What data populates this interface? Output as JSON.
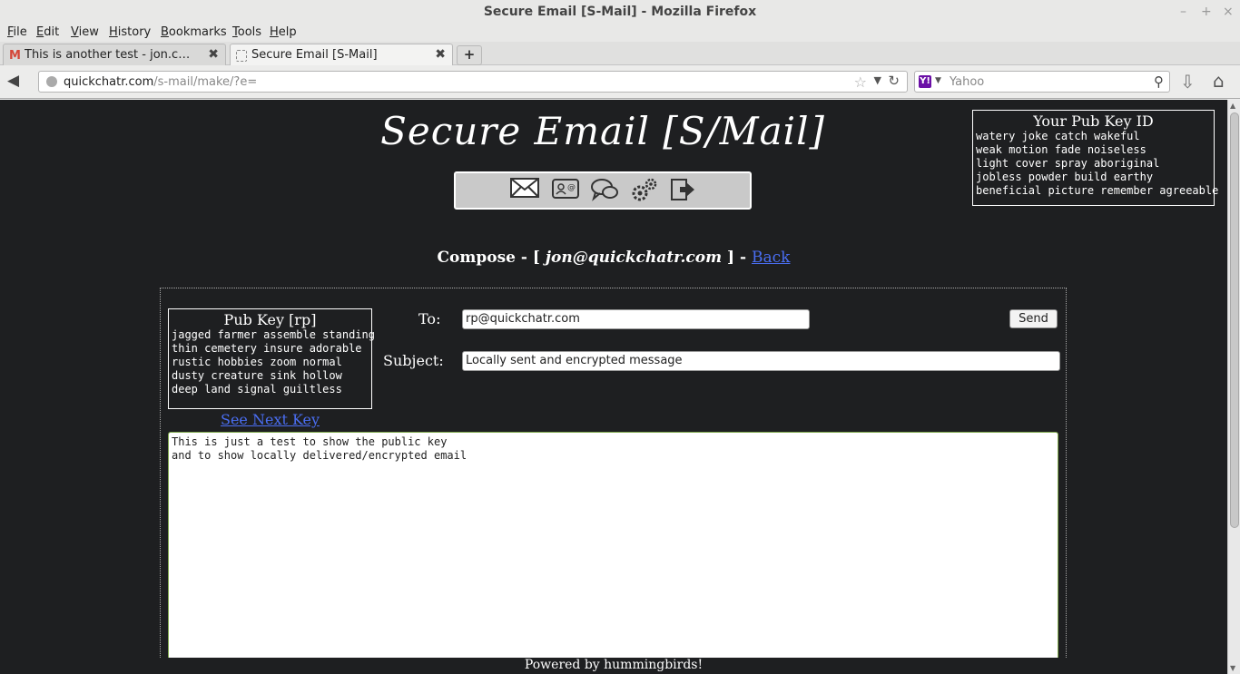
{
  "window": {
    "title": "Secure Email [S-Mail] - Mozilla Firefox",
    "controls": [
      "–",
      "+",
      "×"
    ]
  },
  "menu": [
    "File",
    "Edit",
    "View",
    "History",
    "Bookmarks",
    "Tools",
    "Help"
  ],
  "tabs": [
    {
      "label": "This is another test - jon.chiap...",
      "icon": "gmail-icon",
      "active": false
    },
    {
      "label": "Secure Email [S-Mail]",
      "icon": "page-icon",
      "active": true
    }
  ],
  "tab_close": "✖",
  "new_tab": "+",
  "nav": {
    "url_host": "quickchatr.com",
    "url_path": "/s-mail/make/?e=",
    "search_engine_badge": "Y!",
    "search_placeholder": "Yahoo"
  },
  "page": {
    "site_title": "Secure Email [S/Mail]",
    "your_pub_key": {
      "title": "Your Pub Key ID",
      "lines": [
        "watery joke catch wakeful",
        "weak motion fade noiseless",
        "light cover spray aboriginal",
        "jobless powder build earthy",
        "beneficial picture remember agreeable"
      ]
    },
    "compose": {
      "prefix": "Compose - [",
      "email": "jon@quickchatr.com",
      "suffix": "] -",
      "back_label": "Back"
    },
    "recipient_key": {
      "title": "Pub Key [rp]",
      "lines": [
        "jagged farmer assemble standing",
        "thin cemetery insure adorable",
        "rustic hobbies zoom normal",
        "dusty creature sink hollow",
        "deep land signal guiltless"
      ],
      "next_label": "See Next Key"
    },
    "form": {
      "to_label": "To:",
      "to_value": "rp@quickchatr.com",
      "subject_label": "Subject:",
      "subject_value": "Locally sent and encrypted message",
      "send_label": "Send",
      "body": "This is just a test to show the public key\nand to show locally delivered/encrypted email"
    },
    "footer": "Powered by hummingbirds!"
  }
}
